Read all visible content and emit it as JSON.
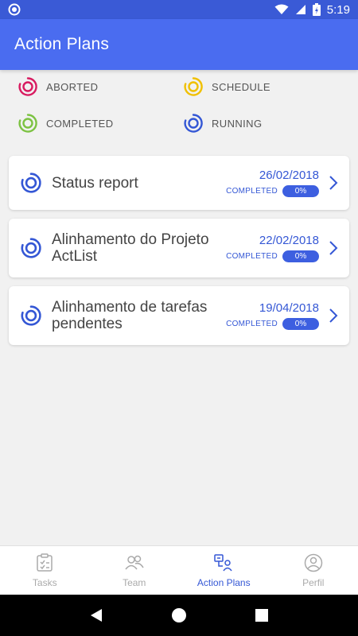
{
  "status_bar": {
    "time": "5:19"
  },
  "app_bar": {
    "title": "Action Plans"
  },
  "legend": [
    {
      "label": "ABORTED",
      "color": "#d81b60"
    },
    {
      "label": "SCHEDULE",
      "color": "#f0c000"
    },
    {
      "label": "COMPLETED",
      "color": "#7cc242"
    },
    {
      "label": "RUNNING",
      "color": "#3457d5"
    }
  ],
  "plans": [
    {
      "title": "Status report",
      "date": "26/02/2018",
      "status": "COMPLETED",
      "progress": "0%",
      "ring_color": "#3457d5"
    },
    {
      "title": "Alinhamento do Projeto ActList",
      "date": "22/02/2018",
      "status": "COMPLETED",
      "progress": "0%",
      "ring_color": "#3457d5"
    },
    {
      "title": "Alinhamento de tarefas pendentes",
      "date": "19/04/2018",
      "status": "COMPLETED",
      "progress": "0%",
      "ring_color": "#3457d5"
    }
  ],
  "bottom_nav": [
    {
      "label": "Tasks",
      "icon": "tasks-icon",
      "active": false
    },
    {
      "label": "Team",
      "icon": "team-icon",
      "active": false
    },
    {
      "label": "Action Plans",
      "icon": "action-plans-icon",
      "active": true
    },
    {
      "label": "Perfil",
      "icon": "profile-icon",
      "active": false
    }
  ],
  "colors": {
    "primary": "#4a6cf0",
    "accent": "#3457d5",
    "background": "#f1f1f1"
  }
}
